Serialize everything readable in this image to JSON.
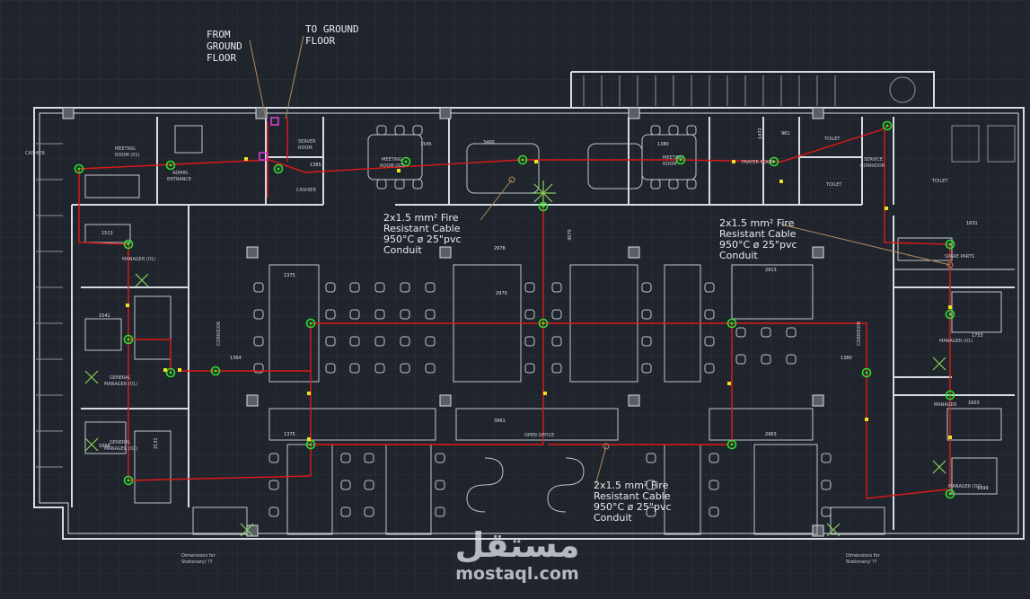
{
  "annotations": {
    "from_ground": [
      "FROM",
      "GROUND",
      "FLOOR"
    ],
    "to_ground": [
      "TO GROUND",
      "FLOOR"
    ],
    "cable_1": [
      "2x1.5 mm² Fire",
      "Resistant Cable",
      "950°C ø 25\"pvc",
      "Conduit"
    ],
    "cable_2": [
      "2x1.5 mm² Fire",
      "Resistant Cable",
      "950°C ø 25\"pvc",
      "Conduit"
    ],
    "cable_3": [
      "2x1.5 mm² Fire",
      "Resistant Cable",
      "950°C ø 25\"pvc",
      "Conduit"
    ]
  },
  "rooms": {
    "cashier_left": "CASHIER",
    "meeting_room_1": [
      "MEETING",
      "ROOM (01)"
    ],
    "admin_entrance": [
      "ADMIN.",
      "ENTRANCE"
    ],
    "server_room": [
      "SERVER",
      "ROOM"
    ],
    "cashier": "CASHIER",
    "meeting_room_2": [
      "MEETING",
      "ROOM (02)"
    ],
    "meeting_room_3": [
      "MEETING",
      "ROOM"
    ],
    "prayer_room": "PRAYER ROOM",
    "toilet_1": "TOILET",
    "toilet_2": "TOILET",
    "service_corridor": [
      "SERVICE",
      "CORRIDOR"
    ],
    "toilet_3": "TOILET",
    "spare_parts": "SPARE PARTS",
    "manager_01": "MANAGER (01)",
    "manager_r1": "MANAGER (01)",
    "manager_r2": "MANAGER",
    "manager_r3": "MANAGER (02)",
    "general_manager_01": [
      "GENERAL",
      "MANAGER (01)"
    ],
    "general_manager_02": [
      "GENERAL",
      "MANAGER (02)"
    ],
    "corridor_left": "CORRIDOR",
    "corridor_right": "CORRIDOR",
    "open_office": "OPEN OFFICE",
    "dims_left": [
      "Dimensions for",
      "Stationary/ ??"
    ],
    "dims_right": [
      "Dimensions for",
      "Stationary/ ??"
    ]
  },
  "dimensions": {
    "d1": "2970",
    "d2": "1375",
    "d3": "2913",
    "d4": "1631",
    "d5": "3400",
    "d6": "1472",
    "d7": "961",
    "d8": "1545",
    "d9": "1364",
    "d10": "3070",
    "d11": "1541",
    "d12": "1380",
    "d13": "1753",
    "d14": "1375",
    "d15": "3961",
    "d16": "2963",
    "d17": "1603",
    "d18": "1699",
    "d19": "1513",
    "d20": "1365",
    "d21": "1380",
    "d22": "2978",
    "d23": "1668",
    "d24": "2131"
  },
  "watermark": {
    "arabic": "مستقل",
    "latin": "mostaql.com"
  },
  "colors": {
    "background": "#20252d",
    "wall": "#d8dce2",
    "cable": "#e01818",
    "detector": "#2ee02e",
    "leader": "#b08a60",
    "furniture": "#bfc4cb"
  }
}
